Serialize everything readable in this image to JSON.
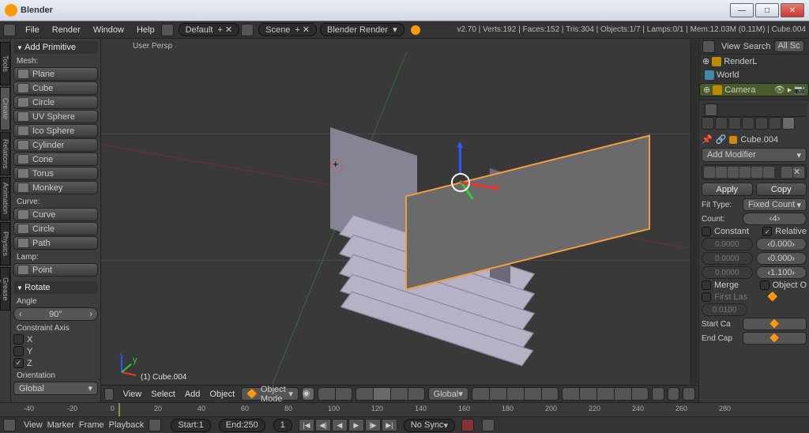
{
  "window": {
    "title": "Blender"
  },
  "topmenu": {
    "file": "File",
    "render": "Render",
    "window": "Window",
    "help": "Help",
    "layout": "Default",
    "scene": "Scene",
    "engine": "Blender Render"
  },
  "stats": "v2.70 | Verts:192 | Faces:152 | Tris:304 | Objects:1/7 | Lamps:0/1 | Mem:12.03M (0.11M) | Cube.004",
  "tool": {
    "add_primitive": "Add Primitive",
    "mesh": "Mesh:",
    "prims": [
      "Plane",
      "Cube",
      "Circle",
      "UV Sphere",
      "Ico Sphere",
      "Cylinder",
      "Cone",
      "Torus",
      "Monkey"
    ],
    "curve": "Curve:",
    "curves": [
      "Curve",
      "Circle",
      "Path"
    ],
    "lamp": "Lamp:",
    "lamps": [
      "Point"
    ],
    "rotate": "Rotate",
    "angle_lbl": "Angle",
    "angle_val": "90° ",
    "constraint": "Constraint Axis",
    "x": "X",
    "y": "Y",
    "z": "Z",
    "orientation": "Orientation",
    "orient_val": "Global"
  },
  "vp": {
    "persp": "User Persp",
    "obj": "(1) Cube.004",
    "view": "View",
    "select": "Select",
    "add": "Add",
    "object": "Object",
    "mode": "Object Mode",
    "orient": "Global"
  },
  "outliner": {
    "view": "View",
    "search": "Search",
    "all": "All Sc",
    "items": [
      {
        "name": "RenderL"
      },
      {
        "name": "World"
      },
      {
        "name": "Camera"
      }
    ]
  },
  "props": {
    "obj": "Cube.004",
    "add_mod": "Add Modifier",
    "apply": "Apply",
    "copy": "Copy",
    "fit_type": "Fit Type:",
    "fit_val": "Fixed Count",
    "count": "Count:",
    "count_val": "4",
    "constant": "Constant",
    "relative": "Relative",
    "c_x": "0.0000",
    "c_y": "0.0000",
    "c_z": "0.0000",
    "r_x": "0.000",
    "r_y": "0.000",
    "r_z": "1.100",
    "merge": "Merge",
    "objecto": "Object O",
    "first": "First Las",
    "first_v": "0.0100",
    "startcap": "Start Ca",
    "endcap": "End Cap"
  },
  "timeline": {
    "ticks": [
      "-40",
      "-20",
      "0",
      "20",
      "40",
      "60",
      "80",
      "100",
      "120",
      "140",
      "160",
      "180",
      "200",
      "220",
      "240",
      "260",
      "280"
    ],
    "view": "View",
    "marker": "Marker",
    "frame": "Frame",
    "playback": "Playback",
    "start": "Start:",
    "start_v": "1",
    "end": "End:",
    "end_v": "250",
    "cur": "1",
    "sync": "No Sync"
  }
}
